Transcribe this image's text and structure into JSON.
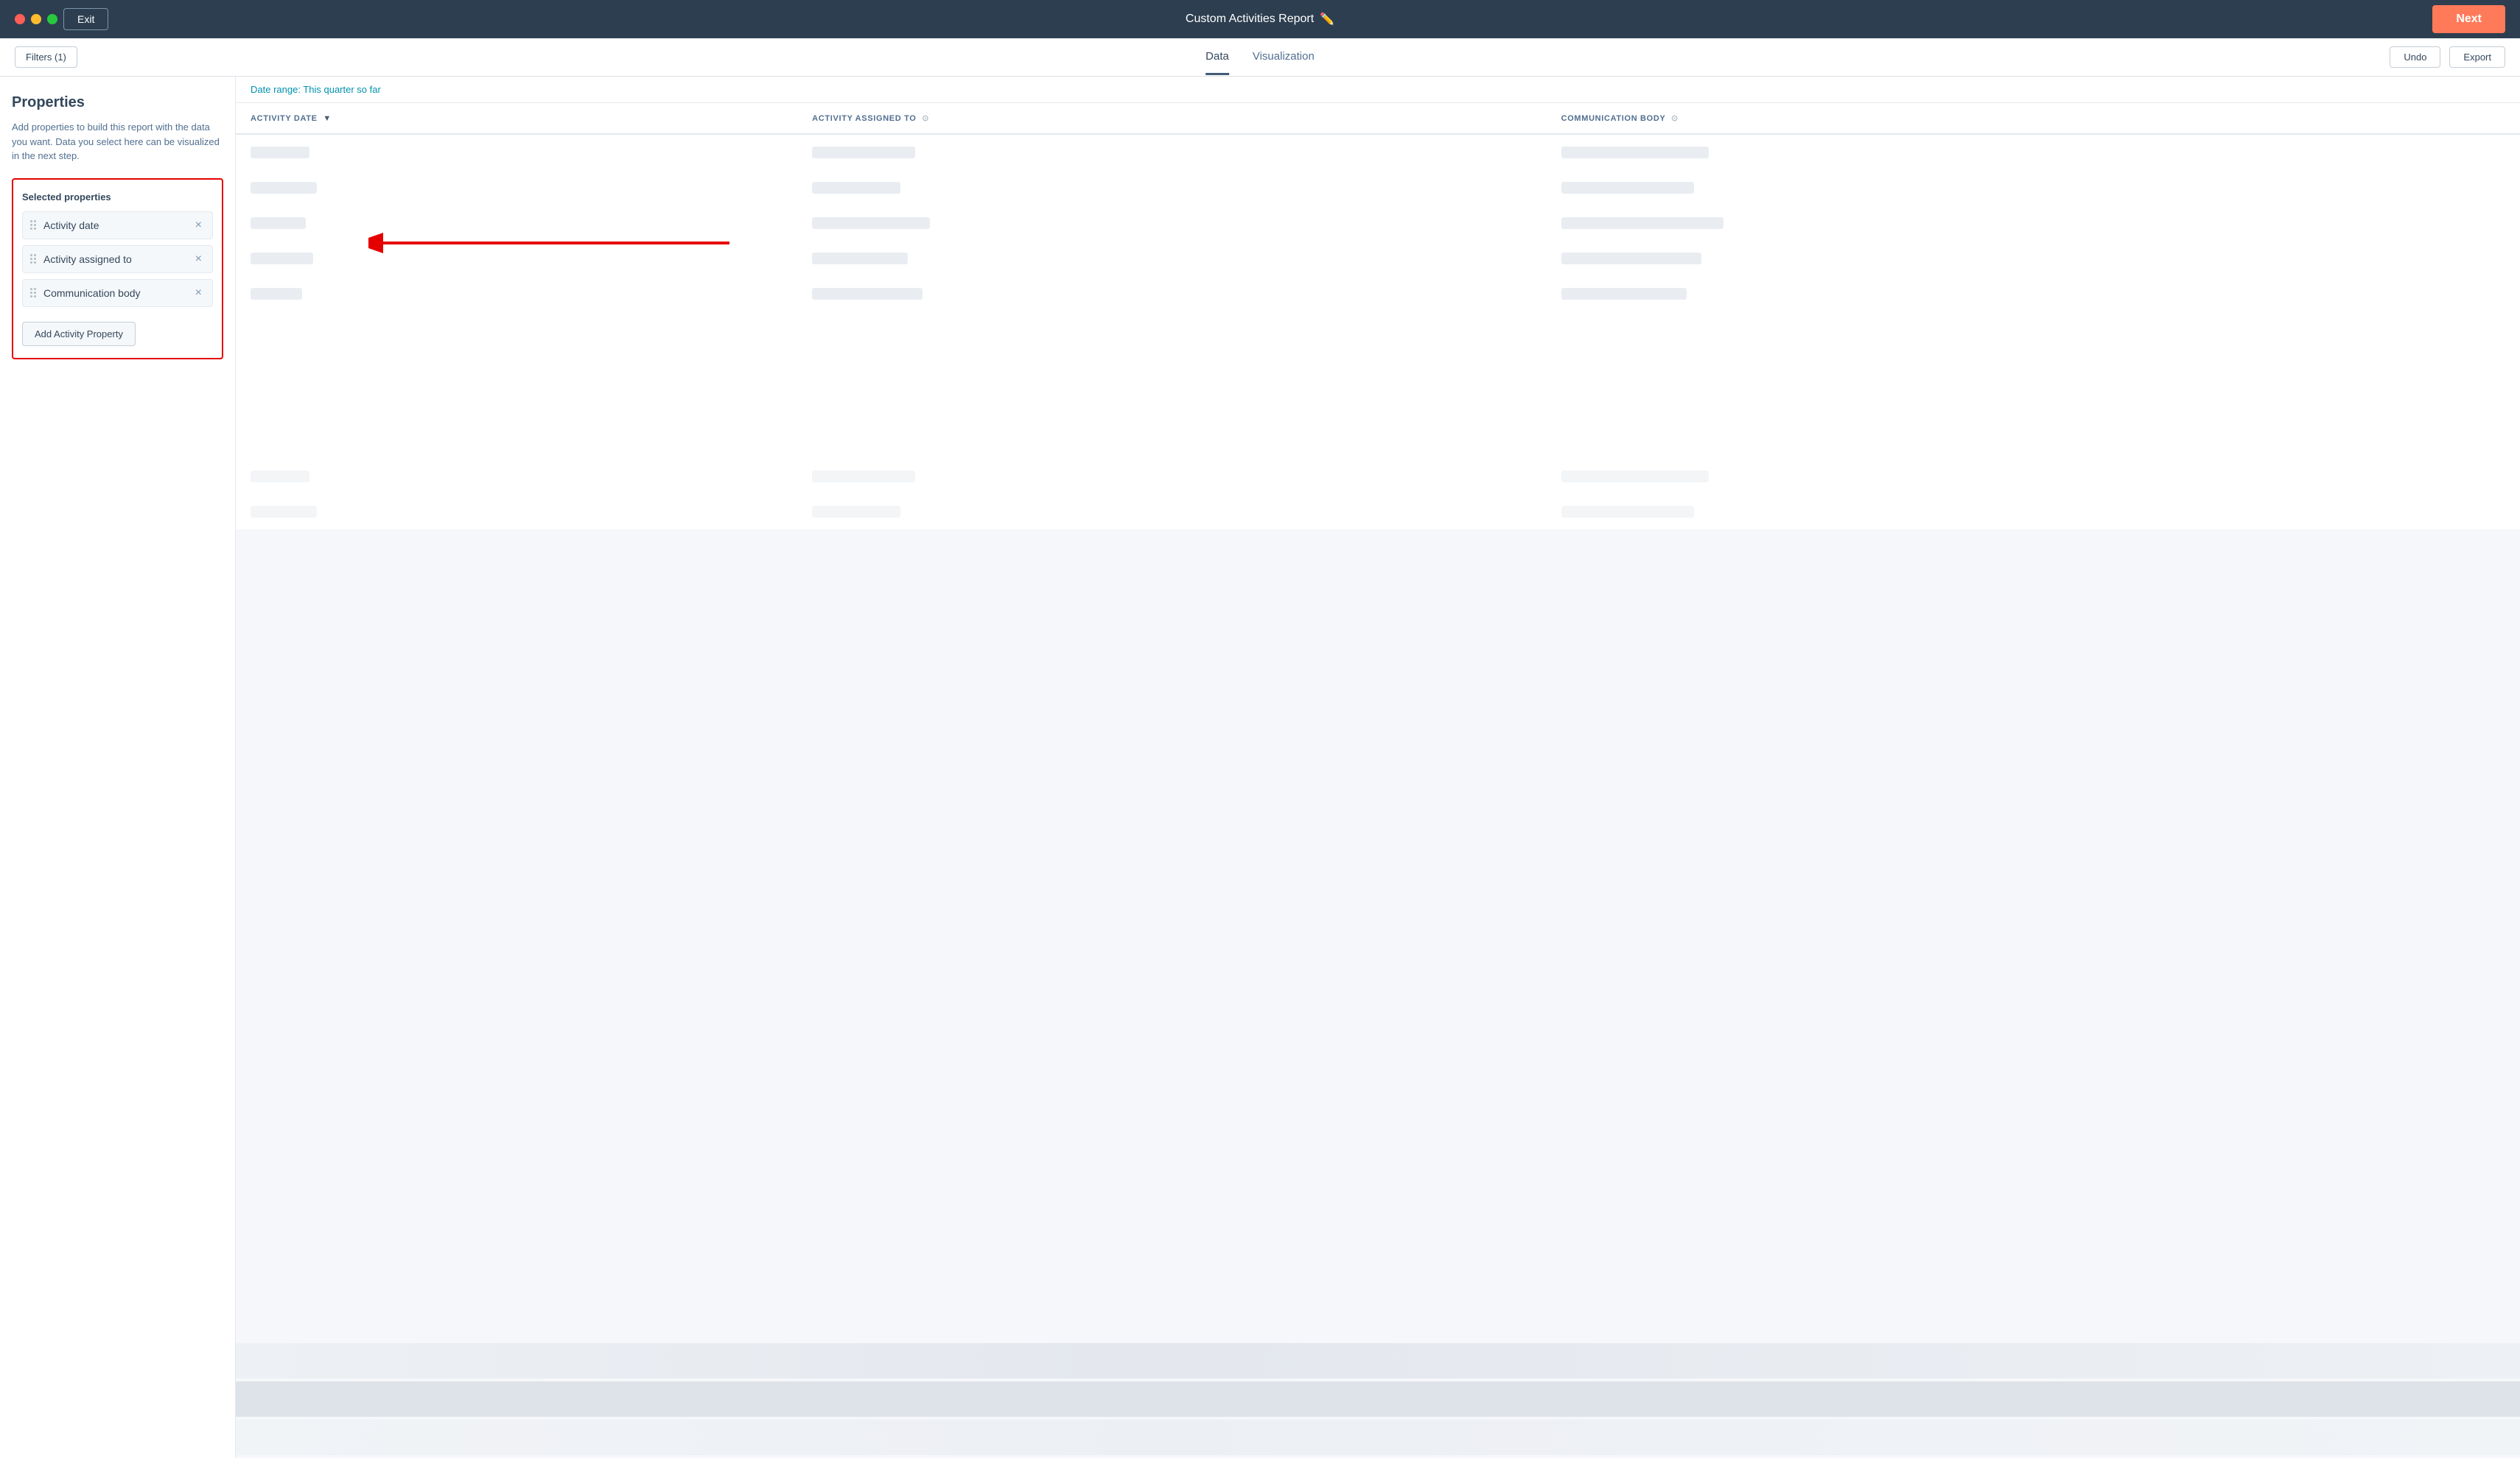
{
  "titlebar": {
    "exit_label": "Exit",
    "title": "Custom Activities Report",
    "next_label": "Next"
  },
  "toolbar": {
    "filters_label": "Filters (1)",
    "tabs": [
      {
        "label": "Data",
        "active": true
      },
      {
        "label": "Visualization",
        "active": false
      }
    ],
    "undo_label": "Undo",
    "export_label": "Export"
  },
  "sidebar": {
    "title": "Properties",
    "description": "Add properties to build this report with the data you want. Data you select here can be visualized in the next step.",
    "selected_properties_label": "Selected properties",
    "properties": [
      {
        "name": "Activity date"
      },
      {
        "name": "Activity assigned to"
      },
      {
        "name": "Communication body"
      }
    ],
    "add_button_label": "Add Activity Property"
  },
  "content": {
    "date_range_prefix": "Date range: ",
    "date_range_value": "This quarter so far",
    "columns": [
      {
        "label": "ACTIVITY DATE",
        "sort": true,
        "filter": false
      },
      {
        "label": "ACTIVITY ASSIGNED TO",
        "sort": false,
        "filter": true
      },
      {
        "label": "COMMUNICATION BODY",
        "sort": false,
        "filter": true
      }
    ]
  }
}
